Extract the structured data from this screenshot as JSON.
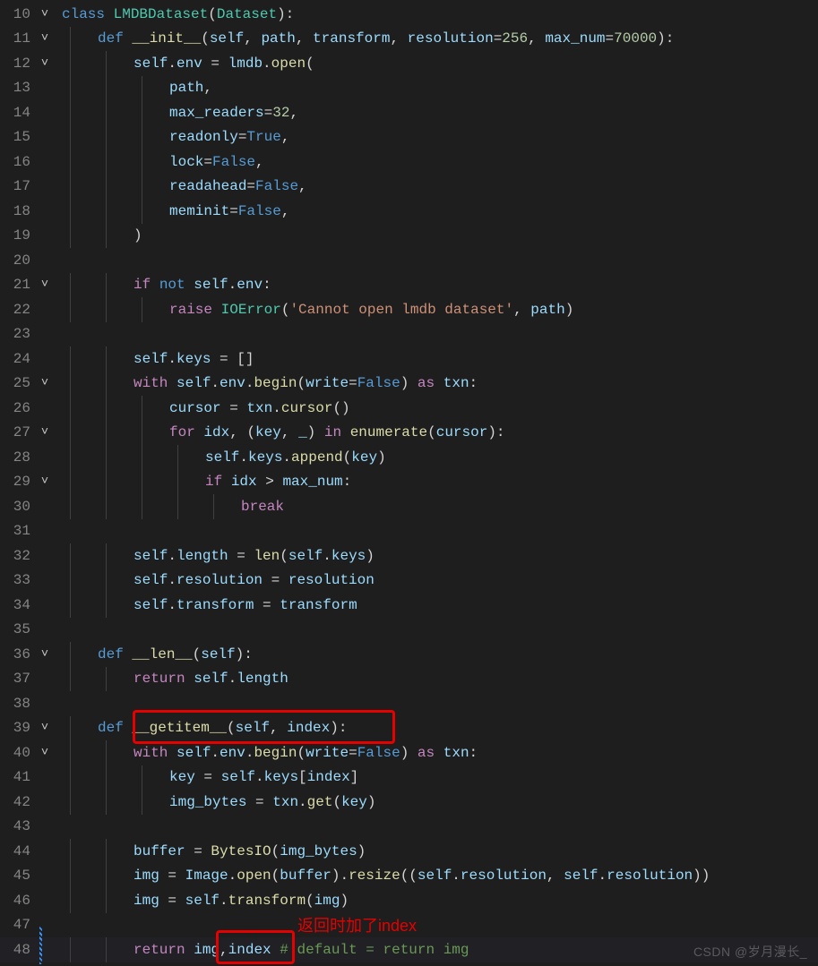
{
  "lines": [
    {
      "n": 10,
      "fold": "v",
      "indent": 0,
      "tokens": [
        {
          "c": "kw",
          "t": "class "
        },
        {
          "c": "cls",
          "t": "LMDBDataset"
        },
        {
          "c": "op",
          "t": "("
        },
        {
          "c": "cls",
          "t": "Dataset"
        },
        {
          "c": "op",
          "t": "):"
        }
      ]
    },
    {
      "n": 11,
      "fold": "v",
      "indent": 1,
      "tokens": [
        {
          "c": "kw",
          "t": "def "
        },
        {
          "c": "fn",
          "t": "__init__"
        },
        {
          "c": "op",
          "t": "("
        },
        {
          "c": "var",
          "t": "self"
        },
        {
          "c": "op",
          "t": ", "
        },
        {
          "c": "var",
          "t": "path"
        },
        {
          "c": "op",
          "t": ", "
        },
        {
          "c": "var",
          "t": "transform"
        },
        {
          "c": "op",
          "t": ", "
        },
        {
          "c": "var",
          "t": "resolution"
        },
        {
          "c": "op",
          "t": "="
        },
        {
          "c": "num",
          "t": "256"
        },
        {
          "c": "op",
          "t": ", "
        },
        {
          "c": "var",
          "t": "max_num"
        },
        {
          "c": "op",
          "t": "="
        },
        {
          "c": "num",
          "t": "70000"
        },
        {
          "c": "op",
          "t": "):"
        }
      ]
    },
    {
      "n": 12,
      "fold": "v",
      "indent": 2,
      "tokens": [
        {
          "c": "var",
          "t": "self"
        },
        {
          "c": "op",
          "t": "."
        },
        {
          "c": "var",
          "t": "env"
        },
        {
          "c": "op",
          "t": " = "
        },
        {
          "c": "var",
          "t": "lmdb"
        },
        {
          "c": "op",
          "t": "."
        },
        {
          "c": "fn",
          "t": "open"
        },
        {
          "c": "op",
          "t": "("
        }
      ]
    },
    {
      "n": 13,
      "fold": "",
      "indent": 3,
      "tokens": [
        {
          "c": "var",
          "t": "path"
        },
        {
          "c": "op",
          "t": ","
        }
      ]
    },
    {
      "n": 14,
      "fold": "",
      "indent": 3,
      "tokens": [
        {
          "c": "var",
          "t": "max_readers"
        },
        {
          "c": "op",
          "t": "="
        },
        {
          "c": "num",
          "t": "32"
        },
        {
          "c": "op",
          "t": ","
        }
      ]
    },
    {
      "n": 15,
      "fold": "",
      "indent": 3,
      "tokens": [
        {
          "c": "var",
          "t": "readonly"
        },
        {
          "c": "op",
          "t": "="
        },
        {
          "c": "const",
          "t": "True"
        },
        {
          "c": "op",
          "t": ","
        }
      ]
    },
    {
      "n": 16,
      "fold": "",
      "indent": 3,
      "tokens": [
        {
          "c": "var",
          "t": "lock"
        },
        {
          "c": "op",
          "t": "="
        },
        {
          "c": "const",
          "t": "False"
        },
        {
          "c": "op",
          "t": ","
        }
      ]
    },
    {
      "n": 17,
      "fold": "",
      "indent": 3,
      "tokens": [
        {
          "c": "var",
          "t": "readahead"
        },
        {
          "c": "op",
          "t": "="
        },
        {
          "c": "const",
          "t": "False"
        },
        {
          "c": "op",
          "t": ","
        }
      ]
    },
    {
      "n": 18,
      "fold": "",
      "indent": 3,
      "tokens": [
        {
          "c": "var",
          "t": "meminit"
        },
        {
          "c": "op",
          "t": "="
        },
        {
          "c": "const",
          "t": "False"
        },
        {
          "c": "op",
          "t": ","
        }
      ]
    },
    {
      "n": 19,
      "fold": "",
      "indent": 2,
      "tokens": [
        {
          "c": "op",
          "t": ")"
        }
      ]
    },
    {
      "n": 20,
      "fold": "",
      "indent": 0,
      "tokens": []
    },
    {
      "n": 21,
      "fold": "v",
      "indent": 2,
      "tokens": [
        {
          "c": "kw2",
          "t": "if"
        },
        {
          "c": "op",
          "t": " "
        },
        {
          "c": "kw",
          "t": "not"
        },
        {
          "c": "op",
          "t": " "
        },
        {
          "c": "var",
          "t": "self"
        },
        {
          "c": "op",
          "t": "."
        },
        {
          "c": "var",
          "t": "env"
        },
        {
          "c": "op",
          "t": ":"
        }
      ]
    },
    {
      "n": 22,
      "fold": "",
      "indent": 3,
      "tokens": [
        {
          "c": "kw2",
          "t": "raise"
        },
        {
          "c": "op",
          "t": " "
        },
        {
          "c": "cls",
          "t": "IOError"
        },
        {
          "c": "op",
          "t": "("
        },
        {
          "c": "str",
          "t": "'Cannot open lmdb dataset'"
        },
        {
          "c": "op",
          "t": ", "
        },
        {
          "c": "var",
          "t": "path"
        },
        {
          "c": "op",
          "t": ")"
        }
      ]
    },
    {
      "n": 23,
      "fold": "",
      "indent": 0,
      "tokens": []
    },
    {
      "n": 24,
      "fold": "",
      "indent": 2,
      "tokens": [
        {
          "c": "var",
          "t": "self"
        },
        {
          "c": "op",
          "t": "."
        },
        {
          "c": "var",
          "t": "keys"
        },
        {
          "c": "op",
          "t": " = []"
        }
      ]
    },
    {
      "n": 25,
      "fold": "v",
      "indent": 2,
      "tokens": [
        {
          "c": "kw2",
          "t": "with"
        },
        {
          "c": "op",
          "t": " "
        },
        {
          "c": "var",
          "t": "self"
        },
        {
          "c": "op",
          "t": "."
        },
        {
          "c": "var",
          "t": "env"
        },
        {
          "c": "op",
          "t": "."
        },
        {
          "c": "fn",
          "t": "begin"
        },
        {
          "c": "op",
          "t": "("
        },
        {
          "c": "var",
          "t": "write"
        },
        {
          "c": "op",
          "t": "="
        },
        {
          "c": "const",
          "t": "False"
        },
        {
          "c": "op",
          "t": ") "
        },
        {
          "c": "kw2",
          "t": "as"
        },
        {
          "c": "op",
          "t": " "
        },
        {
          "c": "var",
          "t": "txn"
        },
        {
          "c": "op",
          "t": ":"
        }
      ]
    },
    {
      "n": 26,
      "fold": "",
      "indent": 3,
      "tokens": [
        {
          "c": "var",
          "t": "cursor"
        },
        {
          "c": "op",
          "t": " = "
        },
        {
          "c": "var",
          "t": "txn"
        },
        {
          "c": "op",
          "t": "."
        },
        {
          "c": "fn",
          "t": "cursor"
        },
        {
          "c": "op",
          "t": "()"
        }
      ]
    },
    {
      "n": 27,
      "fold": "v",
      "indent": 3,
      "tokens": [
        {
          "c": "kw2",
          "t": "for"
        },
        {
          "c": "op",
          "t": " "
        },
        {
          "c": "var",
          "t": "idx"
        },
        {
          "c": "op",
          "t": ", ("
        },
        {
          "c": "var",
          "t": "key"
        },
        {
          "c": "op",
          "t": ", "
        },
        {
          "c": "var",
          "t": "_"
        },
        {
          "c": "op",
          "t": ") "
        },
        {
          "c": "kw2",
          "t": "in"
        },
        {
          "c": "op",
          "t": " "
        },
        {
          "c": "fn",
          "t": "enumerate"
        },
        {
          "c": "op",
          "t": "("
        },
        {
          "c": "var",
          "t": "cursor"
        },
        {
          "c": "op",
          "t": "):"
        }
      ]
    },
    {
      "n": 28,
      "fold": "",
      "indent": 4,
      "tokens": [
        {
          "c": "var",
          "t": "self"
        },
        {
          "c": "op",
          "t": "."
        },
        {
          "c": "var",
          "t": "keys"
        },
        {
          "c": "op",
          "t": "."
        },
        {
          "c": "fn",
          "t": "append"
        },
        {
          "c": "op",
          "t": "("
        },
        {
          "c": "var",
          "t": "key"
        },
        {
          "c": "op",
          "t": ")"
        }
      ]
    },
    {
      "n": 29,
      "fold": "v",
      "indent": 4,
      "tokens": [
        {
          "c": "kw2",
          "t": "if"
        },
        {
          "c": "op",
          "t": " "
        },
        {
          "c": "var",
          "t": "idx"
        },
        {
          "c": "op",
          "t": " > "
        },
        {
          "c": "var",
          "t": "max_num"
        },
        {
          "c": "op",
          "t": ":"
        }
      ]
    },
    {
      "n": 30,
      "fold": "",
      "indent": 5,
      "tokens": [
        {
          "c": "kw2",
          "t": "break"
        }
      ]
    },
    {
      "n": 31,
      "fold": "",
      "indent": 0,
      "tokens": []
    },
    {
      "n": 32,
      "fold": "",
      "indent": 2,
      "tokens": [
        {
          "c": "var",
          "t": "self"
        },
        {
          "c": "op",
          "t": "."
        },
        {
          "c": "var",
          "t": "length"
        },
        {
          "c": "op",
          "t": " = "
        },
        {
          "c": "fn",
          "t": "len"
        },
        {
          "c": "op",
          "t": "("
        },
        {
          "c": "var",
          "t": "self"
        },
        {
          "c": "op",
          "t": "."
        },
        {
          "c": "var",
          "t": "keys"
        },
        {
          "c": "op",
          "t": ")"
        }
      ]
    },
    {
      "n": 33,
      "fold": "",
      "indent": 2,
      "tokens": [
        {
          "c": "var",
          "t": "self"
        },
        {
          "c": "op",
          "t": "."
        },
        {
          "c": "var",
          "t": "resolution"
        },
        {
          "c": "op",
          "t": " = "
        },
        {
          "c": "var",
          "t": "resolution"
        }
      ]
    },
    {
      "n": 34,
      "fold": "",
      "indent": 2,
      "tokens": [
        {
          "c": "var",
          "t": "self"
        },
        {
          "c": "op",
          "t": "."
        },
        {
          "c": "var",
          "t": "transform"
        },
        {
          "c": "op",
          "t": " = "
        },
        {
          "c": "var",
          "t": "transform"
        }
      ]
    },
    {
      "n": 35,
      "fold": "",
      "indent": 0,
      "tokens": []
    },
    {
      "n": 36,
      "fold": "v",
      "indent": 1,
      "tokens": [
        {
          "c": "kw",
          "t": "def "
        },
        {
          "c": "fn",
          "t": "__len__"
        },
        {
          "c": "op",
          "t": "("
        },
        {
          "c": "var",
          "t": "self"
        },
        {
          "c": "op",
          "t": "):"
        }
      ]
    },
    {
      "n": 37,
      "fold": "",
      "indent": 2,
      "tokens": [
        {
          "c": "kw2",
          "t": "return"
        },
        {
          "c": "op",
          "t": " "
        },
        {
          "c": "var",
          "t": "self"
        },
        {
          "c": "op",
          "t": "."
        },
        {
          "c": "var",
          "t": "length"
        }
      ]
    },
    {
      "n": 38,
      "fold": "",
      "indent": 0,
      "tokens": []
    },
    {
      "n": 39,
      "fold": "v",
      "indent": 1,
      "tokens": [
        {
          "c": "kw",
          "t": "def "
        },
        {
          "c": "fn",
          "t": "__getitem__"
        },
        {
          "c": "op",
          "t": "("
        },
        {
          "c": "var",
          "t": "self"
        },
        {
          "c": "op",
          "t": ", "
        },
        {
          "c": "var",
          "t": "index"
        },
        {
          "c": "op",
          "t": "):"
        }
      ]
    },
    {
      "n": 40,
      "fold": "v",
      "indent": 2,
      "tokens": [
        {
          "c": "kw2",
          "t": "with"
        },
        {
          "c": "op",
          "t": " "
        },
        {
          "c": "var",
          "t": "self"
        },
        {
          "c": "op",
          "t": "."
        },
        {
          "c": "var",
          "t": "env"
        },
        {
          "c": "op",
          "t": "."
        },
        {
          "c": "fn",
          "t": "begin"
        },
        {
          "c": "op",
          "t": "("
        },
        {
          "c": "var",
          "t": "write"
        },
        {
          "c": "op",
          "t": "="
        },
        {
          "c": "const",
          "t": "False"
        },
        {
          "c": "op",
          "t": ") "
        },
        {
          "c": "kw2",
          "t": "as"
        },
        {
          "c": "op",
          "t": " "
        },
        {
          "c": "var",
          "t": "txn"
        },
        {
          "c": "op",
          "t": ":"
        }
      ]
    },
    {
      "n": 41,
      "fold": "",
      "indent": 3,
      "tokens": [
        {
          "c": "var",
          "t": "key"
        },
        {
          "c": "op",
          "t": " = "
        },
        {
          "c": "var",
          "t": "self"
        },
        {
          "c": "op",
          "t": "."
        },
        {
          "c": "var",
          "t": "keys"
        },
        {
          "c": "op",
          "t": "["
        },
        {
          "c": "var",
          "t": "index"
        },
        {
          "c": "op",
          "t": "]"
        }
      ]
    },
    {
      "n": 42,
      "fold": "",
      "indent": 3,
      "tokens": [
        {
          "c": "var",
          "t": "img_bytes"
        },
        {
          "c": "op",
          "t": " = "
        },
        {
          "c": "var",
          "t": "txn"
        },
        {
          "c": "op",
          "t": "."
        },
        {
          "c": "fn",
          "t": "get"
        },
        {
          "c": "op",
          "t": "("
        },
        {
          "c": "var",
          "t": "key"
        },
        {
          "c": "op",
          "t": ")"
        }
      ]
    },
    {
      "n": 43,
      "fold": "",
      "indent": 0,
      "tokens": []
    },
    {
      "n": 44,
      "fold": "",
      "indent": 2,
      "tokens": [
        {
          "c": "var",
          "t": "buffer"
        },
        {
          "c": "op",
          "t": " = "
        },
        {
          "c": "fn",
          "t": "BytesIO"
        },
        {
          "c": "op",
          "t": "("
        },
        {
          "c": "var",
          "t": "img_bytes"
        },
        {
          "c": "op",
          "t": ")"
        }
      ]
    },
    {
      "n": 45,
      "fold": "",
      "indent": 2,
      "tokens": [
        {
          "c": "var",
          "t": "img"
        },
        {
          "c": "op",
          "t": " = "
        },
        {
          "c": "var",
          "t": "Image"
        },
        {
          "c": "op",
          "t": "."
        },
        {
          "c": "fn",
          "t": "open"
        },
        {
          "c": "op",
          "t": "("
        },
        {
          "c": "var",
          "t": "buffer"
        },
        {
          "c": "op",
          "t": ")."
        },
        {
          "c": "fn",
          "t": "resize"
        },
        {
          "c": "op",
          "t": "(("
        },
        {
          "c": "var",
          "t": "self"
        },
        {
          "c": "op",
          "t": "."
        },
        {
          "c": "var",
          "t": "resolution"
        },
        {
          "c": "op",
          "t": ", "
        },
        {
          "c": "var",
          "t": "self"
        },
        {
          "c": "op",
          "t": "."
        },
        {
          "c": "var",
          "t": "resolution"
        },
        {
          "c": "op",
          "t": "))"
        }
      ]
    },
    {
      "n": 46,
      "fold": "",
      "indent": 2,
      "tokens": [
        {
          "c": "var",
          "t": "img"
        },
        {
          "c": "op",
          "t": " = "
        },
        {
          "c": "var",
          "t": "self"
        },
        {
          "c": "op",
          "t": "."
        },
        {
          "c": "fn",
          "t": "transform"
        },
        {
          "c": "op",
          "t": "("
        },
        {
          "c": "var",
          "t": "img"
        },
        {
          "c": "op",
          "t": ")"
        }
      ]
    },
    {
      "n": 47,
      "fold": "",
      "indent": 0,
      "tokens": []
    },
    {
      "n": 48,
      "fold": "",
      "indent": 2,
      "hl": true,
      "tokens": [
        {
          "c": "kw2",
          "t": "return"
        },
        {
          "c": "op",
          "t": " "
        },
        {
          "c": "var",
          "t": "img"
        },
        {
          "c": "op",
          "t": ","
        },
        {
          "c": "var",
          "t": "index"
        },
        {
          "c": "op",
          "t": " "
        },
        {
          "c": "cmt",
          "t": "# default = return img"
        }
      ]
    }
  ],
  "annotations": {
    "box1": "__getitem__(self, index):",
    "box2": ",index",
    "red_text": "返回时加了index"
  },
  "watermark": "CSDN @岁月漫长_"
}
